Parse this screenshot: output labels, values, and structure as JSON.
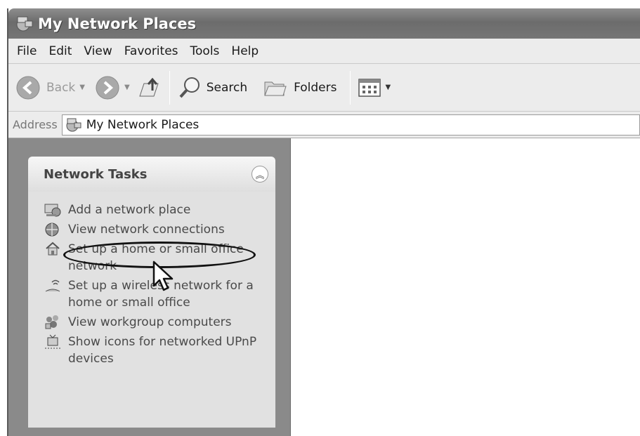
{
  "window": {
    "title": "My Network Places"
  },
  "menu": {
    "items": [
      "File",
      "Edit",
      "View",
      "Favorites",
      "Tools",
      "Help"
    ]
  },
  "toolbar": {
    "back_label": "Back",
    "search_label": "Search",
    "folders_label": "Folders"
  },
  "address": {
    "label": "Address",
    "value": "My Network Places"
  },
  "tasks": {
    "title": "Network Tasks",
    "items": [
      {
        "label": "Add a network place",
        "icon": "add-network-place-icon"
      },
      {
        "label": "View network connections",
        "icon": "network-connections-icon"
      },
      {
        "label": "Set up a home or small office network",
        "icon": "home-network-setup-icon"
      },
      {
        "label": "Set up a wireless network for a home or small office",
        "icon": "wireless-network-icon"
      },
      {
        "label": "View workgroup computers",
        "icon": "workgroup-computers-icon"
      },
      {
        "label": "Show icons for networked UPnP devices",
        "icon": "upnp-devices-icon"
      }
    ]
  }
}
